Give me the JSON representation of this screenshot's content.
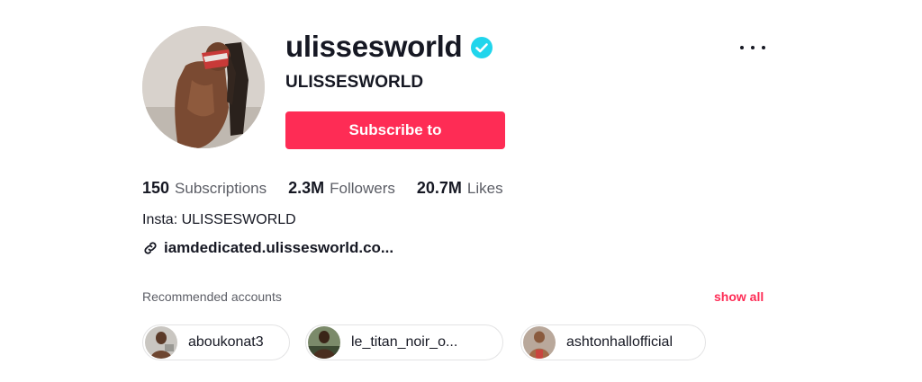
{
  "profile": {
    "username": "ulissesworld",
    "nickname": "ULISSESWORLD",
    "verified": true,
    "avatar_icon": "profile-photo",
    "subscribe_label": "Subscribe to",
    "more_icon": "more-options-icon"
  },
  "stats": {
    "subscriptions": {
      "value": "150",
      "label": "Subscriptions"
    },
    "followers": {
      "value": "2.3M",
      "label": "Followers"
    },
    "likes": {
      "value": "20.7M",
      "label": "Likes"
    }
  },
  "bio": {
    "text": "Insta: ULISSESWORLD",
    "link": "iamdedicated.ulissesworld.co...",
    "link_icon": "link-icon"
  },
  "recommended": {
    "title": "Recommended accounts",
    "show_all": "show all",
    "accounts": [
      {
        "name": "aboukonat3"
      },
      {
        "name": "le_titan_noir_o..."
      },
      {
        "name": "ashtonhallofficial"
      }
    ]
  },
  "colors": {
    "accent": "#fe2c55",
    "verified": "#20d5ec",
    "text_primary": "#161823",
    "text_secondary": "#5c5e66"
  }
}
